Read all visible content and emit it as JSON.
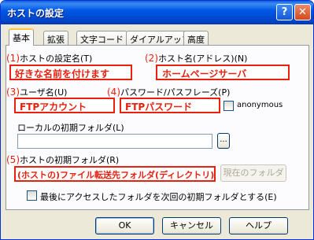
{
  "window": {
    "title": "ホストの設定",
    "help_glyph": "?",
    "close_glyph": "✕"
  },
  "tabs": [
    {
      "label": "基本",
      "active": true
    },
    {
      "label": "拡張"
    },
    {
      "label": "文字コード"
    },
    {
      "label": "ダイアルアップ"
    },
    {
      "label": "高度"
    }
  ],
  "fields": {
    "setting_name": {
      "number": "(1)",
      "label": "ホストの設定名(T)",
      "value": "好きな名前を付けます"
    },
    "host_name": {
      "number": "(2)",
      "label": "ホスト名(アドレス)(N)",
      "value": "ホームページサーバ"
    },
    "user_name": {
      "number": "(3)",
      "label": "ユーザ名(U)",
      "value": "FTPアカウント"
    },
    "password": {
      "number": "(4)",
      "label": "パスワード/パスフレーズ(P)",
      "value": "FTPパスワード"
    },
    "anonymous": {
      "label": "anonymous",
      "checked": false
    },
    "local_folder": {
      "label": "ローカルの初期フォルダ(L)",
      "value": "",
      "browse_label": "..."
    },
    "host_folder": {
      "number": "(5)",
      "label": "ホストの初期フォルダ(R)",
      "value": "(ホストの)ファイル転送先フォルダ(ディレクトリ)",
      "current_folder_label": "現在のフォルダ"
    },
    "last_folder": {
      "label": "最後にアクセスしたフォルダを次回の初期フォルダとする(E)",
      "checked": false
    }
  },
  "buttons": {
    "ok": "OK",
    "cancel": "キャンセル",
    "help": "ヘルプ"
  },
  "colors": {
    "annotation": "#e8200e",
    "titlebar": "#0058e6"
  }
}
